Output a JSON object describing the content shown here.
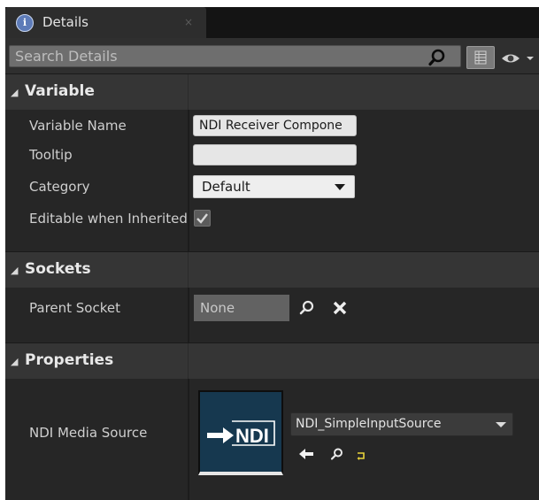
{
  "tab": {
    "title": "Details",
    "icon": "details-icon",
    "close_label": "×"
  },
  "search": {
    "placeholder": "Search Details",
    "value": ""
  },
  "toolbar": {
    "search_icon": "search-icon",
    "grid_icon": "property-matrix-icon",
    "eye_icon": "eye-icon"
  },
  "categories": {
    "variable": {
      "title": "Variable",
      "variable_name_label": "Variable Name",
      "variable_name_value": "NDI Receiver Compone",
      "tooltip_label": "Tooltip",
      "tooltip_value": "",
      "category_label": "Category",
      "category_value": "Default",
      "editable_label": "Editable when Inherited",
      "editable_checked": true
    },
    "sockets": {
      "title": "Sockets",
      "parent_socket_label": "Parent Socket",
      "parent_socket_value": "None"
    },
    "properties": {
      "title": "Properties",
      "media_source_label": "NDI Media Source",
      "media_source_value": "NDI_SimpleInputSource",
      "thumbnail_text": "NDI"
    }
  },
  "colors": {
    "panel_bg": "#242424",
    "header_bg": "#353535",
    "input_bg": "#e6e6e6",
    "thumb_bg": "#16384f",
    "reset_arrow": "#e8d33a"
  }
}
